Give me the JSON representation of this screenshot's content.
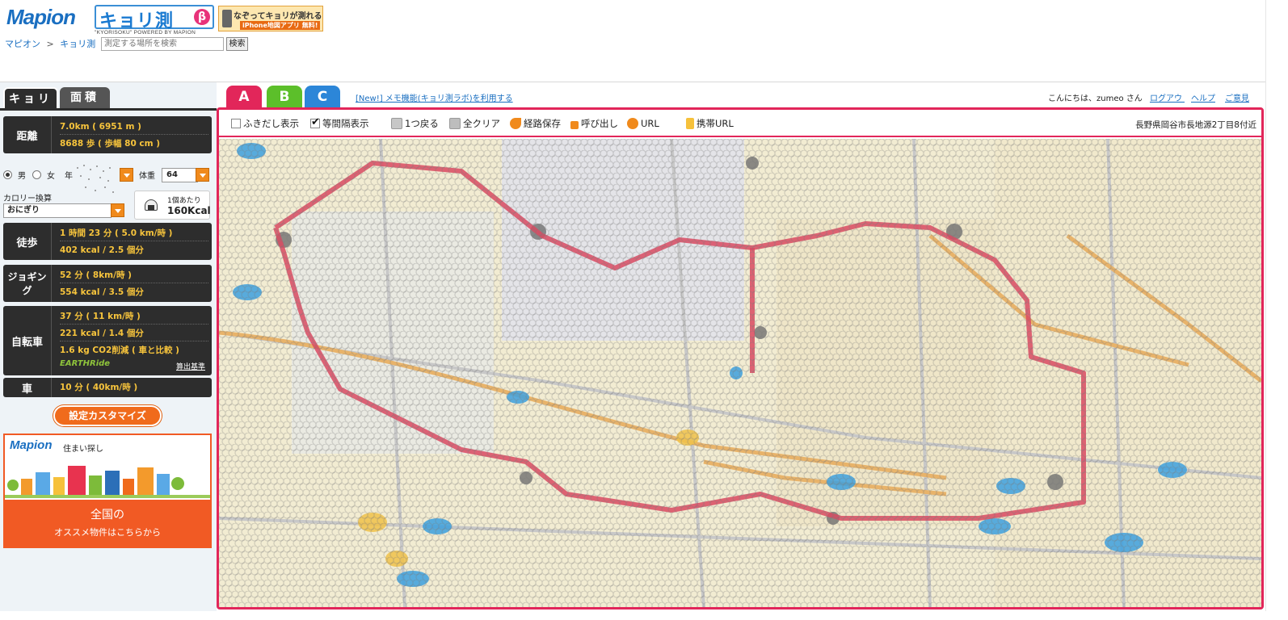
{
  "header": {
    "logo": "Mapion",
    "product": "キョリ測",
    "beta": "β",
    "product_sub": "\"KYORISOKU\" POWERED BY MAPION",
    "promo_line1": "なぞってキョリが測れる",
    "promo_line2": "iPhone地図アプリ 無料!",
    "breadcrumb_home": "マピオン",
    "breadcrumb_sep": ">",
    "breadcrumb_current": "キョリ測",
    "search_placeholder": "測定する場所を検索",
    "search_button": "検索"
  },
  "sidebar": {
    "tab_kyori": "キョリ",
    "tab_menseki": "面積",
    "distance": {
      "label": "距離",
      "km": "7.0km ( 6951 m )",
      "steps": "8688 歩 ( 歩幅 80 cm )"
    },
    "person": {
      "male": "男",
      "female": "女",
      "age_label": "年",
      "weight_label": "体重",
      "weight_value": "64",
      "gender_selected": "male"
    },
    "calorie_label": "カロリー換算",
    "food_value": "おにぎり",
    "per_unit_label": "1個あたり",
    "per_unit_kcal": "160Kcal",
    "walk": {
      "label": "徒歩",
      "time": "1 時間 23 分 ( 5.0 km/時 )",
      "kcal": "402 kcal / 2.5 個分"
    },
    "jog": {
      "label": "ジョギング",
      "time": "52 分 ( 8km/時 )",
      "kcal": "554 kcal / 3.5 個分"
    },
    "bike": {
      "label": "自転車",
      "time": "37 分 ( 11 km/時 )",
      "kcal": "221 kcal / 1.4 個分",
      "co2": "1.6 kg CO2削減 ( 車と比較 )",
      "earth_logo": "EARTHRide",
      "calc_link": "算出基準"
    },
    "car": {
      "label": "車",
      "time": "10 分 ( 40km/時 )"
    },
    "customize_button": "設定カスタマイズ",
    "ad": {
      "logo": "Mapion",
      "title": "住まい探し",
      "line1": "全国の",
      "line2": "オススメ物件はこちらから"
    }
  },
  "main": {
    "tabs": [
      "A",
      "B",
      "C"
    ],
    "active_tab": "A",
    "new_link": "[New!] メモ機能(キョリ測ラボ)を利用する",
    "greeting": "こんにちは、zumeo さん",
    "logout": "ログアウト",
    "help": "ヘルプ",
    "feedback": "ご意見",
    "toolbar": {
      "balloon": "ふきだし表示",
      "equal_interval": "等間隔表示",
      "undo": "1つ戻る",
      "clear_all": "全クリア",
      "save_route": "経路保存",
      "recall": "呼び出し",
      "url": "URL",
      "mobile_url": "携帯URL",
      "balloon_checked": false,
      "equal_interval_checked": true
    },
    "location": "長野県岡谷市長地源2丁目8付近"
  },
  "colors": {
    "accent_pink": "#e2265a",
    "tab_green": "#5cbf2a",
    "tab_blue": "#2c86d8",
    "route_red": "#d94a62",
    "highlight_yellow": "#f7c43c",
    "orange": "#f06b1c"
  }
}
